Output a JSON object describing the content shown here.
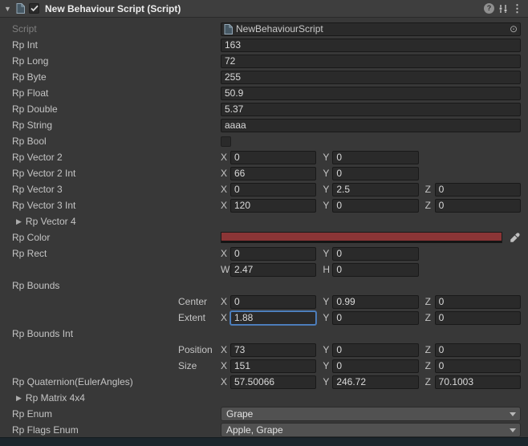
{
  "header": {
    "title": "New Behaviour Script (Script)",
    "enabled": true
  },
  "icons": {
    "fold_open": "▼",
    "fold_closed": "▶",
    "help": "?",
    "menu": "⋮",
    "object_picker": "⊙"
  },
  "colors": {
    "focus_outline": "#4E83C4",
    "rp_color_value": "#8B3536"
  },
  "rows": [
    {
      "label": "Script",
      "type": "object",
      "value": "NewBehaviourScript",
      "disabled": true
    },
    {
      "label": "Rp Int",
      "type": "text",
      "value": "163"
    },
    {
      "label": "Rp Long",
      "type": "text",
      "value": "72"
    },
    {
      "label": "Rp Byte",
      "type": "text",
      "value": "255"
    },
    {
      "label": "Rp Float",
      "type": "text",
      "value": "50.9"
    },
    {
      "label": "Rp Double",
      "type": "text",
      "value": "5.37"
    },
    {
      "label": "Rp String",
      "type": "text",
      "value": "aaaa"
    },
    {
      "label": "Rp Bool",
      "type": "bool",
      "value": false
    },
    {
      "label": "Rp Vector 2",
      "type": "vec",
      "components": [
        {
          "axis": "X",
          "value": "0"
        },
        {
          "axis": "Y",
          "value": "0"
        }
      ]
    },
    {
      "label": "Rp Vector 2 Int",
      "type": "vec",
      "components": [
        {
          "axis": "X",
          "value": "66"
        },
        {
          "axis": "Y",
          "value": "0"
        }
      ]
    },
    {
      "label": "Rp Vector 3",
      "type": "vec",
      "components": [
        {
          "axis": "X",
          "value": "0"
        },
        {
          "axis": "Y",
          "value": "2.5"
        },
        {
          "axis": "Z",
          "value": "0"
        }
      ]
    },
    {
      "label": "Rp Vector 3 Int",
      "type": "vec",
      "components": [
        {
          "axis": "X",
          "value": "120"
        },
        {
          "axis": "Y",
          "value": "0"
        },
        {
          "axis": "Z",
          "value": "0"
        }
      ]
    },
    {
      "label": "Rp Vector 4",
      "type": "foldout"
    },
    {
      "label": "Rp Color",
      "type": "color"
    },
    {
      "label": "Rp Rect",
      "type": "vec",
      "components": [
        {
          "axis": "X",
          "value": "0"
        },
        {
          "axis": "Y",
          "value": "0"
        }
      ]
    },
    {
      "label": "",
      "type": "vec",
      "components": [
        {
          "axis": "W",
          "value": "2.47"
        },
        {
          "axis": "H",
          "value": "0"
        }
      ]
    },
    {
      "label": "Rp Bounds",
      "type": "label"
    },
    {
      "label": "Center",
      "type": "subvec",
      "components": [
        {
          "axis": "X",
          "value": "0"
        },
        {
          "axis": "Y",
          "value": "0.99"
        },
        {
          "axis": "Z",
          "value": "0"
        }
      ]
    },
    {
      "label": "Extent",
      "type": "subvec",
      "components": [
        {
          "axis": "X",
          "value": "1.88",
          "focused": true
        },
        {
          "axis": "Y",
          "value": "0"
        },
        {
          "axis": "Z",
          "value": "0"
        }
      ]
    },
    {
      "label": "Rp Bounds Int",
      "type": "label"
    },
    {
      "label": "Position",
      "type": "subvec",
      "components": [
        {
          "axis": "X",
          "value": "73"
        },
        {
          "axis": "Y",
          "value": "0"
        },
        {
          "axis": "Z",
          "value": "0"
        }
      ]
    },
    {
      "label": "Size",
      "type": "subvec",
      "components": [
        {
          "axis": "X",
          "value": "151"
        },
        {
          "axis": "Y",
          "value": "0"
        },
        {
          "axis": "Z",
          "value": "0"
        }
      ]
    },
    {
      "label": "Rp Quaternion(EulerAngles)",
      "type": "vec",
      "components": [
        {
          "axis": "X",
          "value": "57.50066"
        },
        {
          "axis": "Y",
          "value": "246.72"
        },
        {
          "axis": "Z",
          "value": "70.1003"
        }
      ]
    },
    {
      "label": "Rp Matrix 4x4",
      "type": "foldout"
    },
    {
      "label": "Rp Enum",
      "type": "enum",
      "value": "Grape"
    },
    {
      "label": "Rp Flags Enum",
      "type": "enum",
      "value": "Apple, Grape"
    }
  ]
}
